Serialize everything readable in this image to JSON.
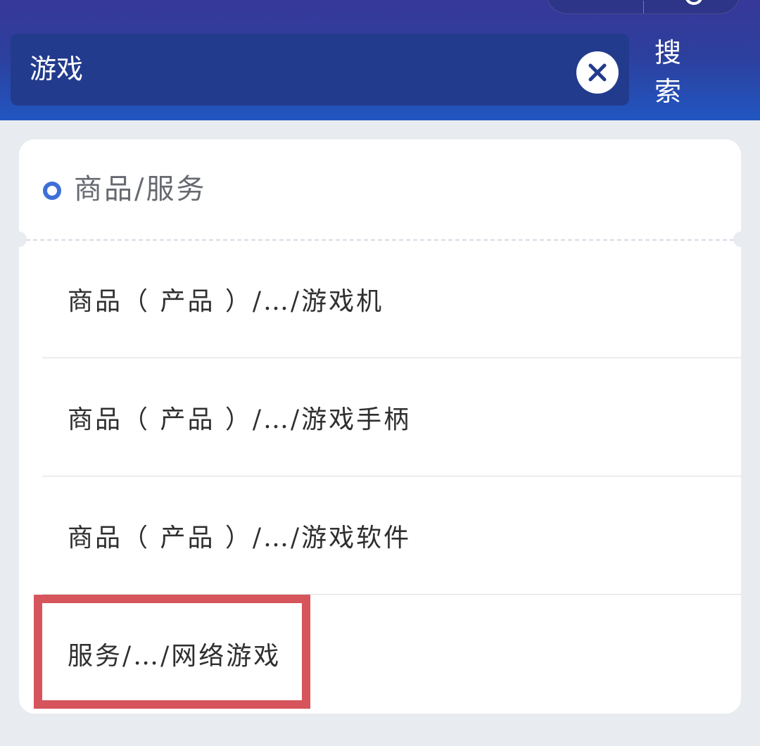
{
  "header": {
    "search": {
      "value": "游戏"
    },
    "search_button_label": "搜 索"
  },
  "results": {
    "section_title": "商品/服务",
    "items": [
      {
        "label": "商品（ 产品 ）/…/游戏机"
      },
      {
        "label": "商品（ 产品 ）/…/游戏手柄"
      },
      {
        "label": "商品（ 产品 ）/…/游戏软件"
      },
      {
        "label": "服务/…/网络游戏",
        "highlighted": true
      }
    ]
  },
  "colors": {
    "header_top": "#37389a",
    "header_bottom": "#2156c1",
    "search_box": "#233b8d",
    "accent": "#3e6fd8",
    "highlight": "#d6545b",
    "background": "#e8ebef"
  },
  "icons": {
    "clear": "close-icon",
    "section_marker": "radio-circle-icon"
  }
}
